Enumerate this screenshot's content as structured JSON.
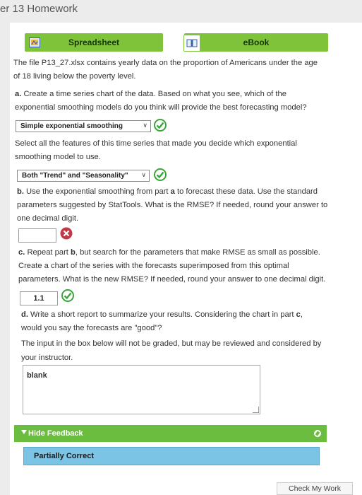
{
  "header": {
    "title": "er 13 Homework"
  },
  "tabs": {
    "spreadsheet": "Spreadsheet",
    "ebook": "eBook"
  },
  "intro": {
    "line1": "The file P13_27.xlsx contains yearly data on the proportion of Americans under the age",
    "line2": "of 18 living below the poverty level."
  },
  "part_a": {
    "label": "a.",
    "line1": " Create a time series chart of the data. Based on what you see, which of the",
    "line2": "exponential smoothing models do you think will provide the best forecasting model?",
    "select1_value": "Simple exponential smoothing",
    "features_line1": "Select all the features of this time series that made you decide which exponential",
    "features_line2": "smoothing model to use.",
    "select2_value": "Both \"Trend\" and \"Seasonality\""
  },
  "part_b": {
    "label": "b.",
    "line1_pre": " Use the exponential smoothing from part ",
    "line1_bold": "a",
    "line1_post": " to forecast these data. Use the standard",
    "line2": "parameters suggested by StatTools. What is the RMSE? If needed, round your answer to",
    "line3": "one decimal digit.",
    "answer": ""
  },
  "part_c": {
    "label": "c.",
    "line1_pre": " Repeat part ",
    "line1_bold": "b",
    "line1_post": ", but search for the parameters that make RMSE as small as possible.",
    "line2": "Create a chart of the series with the forecasts superimposed from this optimal",
    "line3": "parameters. What is the new RMSE? If needed, round your answer to one decimal digit.",
    "answer": "1.1"
  },
  "part_d": {
    "label": "d.",
    "line1_pre": " Write a short report to summarize your results. Considering the chart in part ",
    "line1_bold": "c",
    "line1_post": ",",
    "line2": "would you say the forecasts are \"good\"?",
    "note_line1": "The input in the box below will not be graded, but may be reviewed and considered by",
    "note_line2": "your instructor.",
    "report_text": "blank"
  },
  "feedback": {
    "toggle": "Hide Feedback",
    "status": "Partially Correct"
  },
  "check_work": "Check My Work",
  "colors": {
    "correct": "#3aa63a",
    "incorrect": "#c23a47",
    "tab_green": "#7ec33a"
  }
}
